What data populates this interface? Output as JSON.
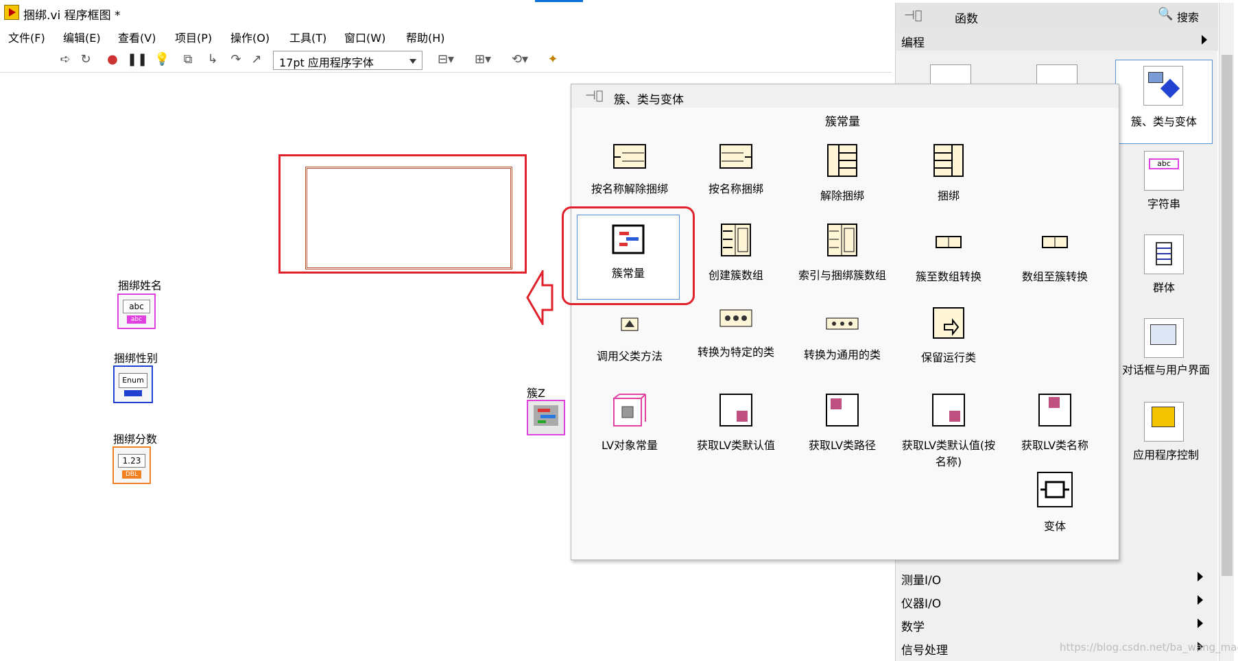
{
  "window": {
    "title": "捆绑.vi 程序框图 *"
  },
  "menu": [
    "文件(F)",
    "编辑(E)",
    "查看(V)",
    "项目(P)",
    "操作(O)",
    "工具(T)",
    "窗口(W)",
    "帮助(H)"
  ],
  "toolbar": {
    "font": "17pt 应用程序字体"
  },
  "diagram": {
    "terminals": [
      {
        "label": "捆绑姓名",
        "value": "abc",
        "sub": "abc",
        "color": "#e040e0"
      },
      {
        "label": "捆绑性别",
        "value": "Enum",
        "sub": "",
        "color": "#2040d0"
      },
      {
        "label": "捆绑分数",
        "value": "1.23",
        "sub": "DBL",
        "color": "#f08020"
      },
      {
        "label": "簇Z",
        "value": "",
        "sub": "",
        "color": "#e040e0"
      }
    ]
  },
  "functions_palette": {
    "title": "函数",
    "search": "搜索",
    "category": "编程",
    "side_items": [
      "簇、类与变体",
      "字符串",
      "群体",
      "对话框与用户界面",
      "应用程序控制"
    ],
    "bottom_items": [
      "测量I/O",
      "仪器I/O",
      "数学",
      "信号处理"
    ]
  },
  "subpalette": {
    "title": "簇、类与变体",
    "tooltip": "簇常量",
    "items": [
      {
        "label": "按名称解除捆绑",
        "icon": "unbundle-by-name-icon"
      },
      {
        "label": "按名称捆绑",
        "icon": "bundle-by-name-icon"
      },
      {
        "label": "解除捆绑",
        "icon": "unbundle-icon"
      },
      {
        "label": "捆绑",
        "icon": "bundle-icon"
      },
      {
        "label": "簇常量",
        "icon": "cluster-constant-icon"
      },
      {
        "label": "创建簇数组",
        "icon": "build-cluster-array-icon"
      },
      {
        "label": "索引与捆绑簇数组",
        "icon": "index-bundle-cluster-array-icon"
      },
      {
        "label": "簇至数组转换",
        "icon": "cluster-to-array-icon"
      },
      {
        "label": "数组至簇转换",
        "icon": "array-to-cluster-icon"
      },
      {
        "label": "调用父类方法",
        "icon": "call-parent-method-icon"
      },
      {
        "label": "转换为特定的类",
        "icon": "to-more-specific-class-icon"
      },
      {
        "label": "转换为通用的类",
        "icon": "to-more-generic-class-icon"
      },
      {
        "label": "保留运行类",
        "icon": "preserve-runtime-class-icon"
      },
      {
        "label": "LV对象常量",
        "icon": "lv-object-constant-icon"
      },
      {
        "label": "获取LV类默认值",
        "icon": "get-lv-class-default-icon"
      },
      {
        "label": "获取LV类路径",
        "icon": "get-lv-class-path-icon"
      },
      {
        "label": "获取LV类默认值(按名称)",
        "icon": "get-lv-class-default-by-name-icon"
      },
      {
        "label": "获取LV类名称",
        "icon": "get-lv-class-name-icon"
      },
      {
        "label": "变体",
        "icon": "variant-icon"
      }
    ]
  },
  "watermark": "https://blog.csdn.net/ba_wang_mao",
  "colors": {
    "highlight_red": "#e0202a",
    "selection_blue": "#4d90d6"
  }
}
